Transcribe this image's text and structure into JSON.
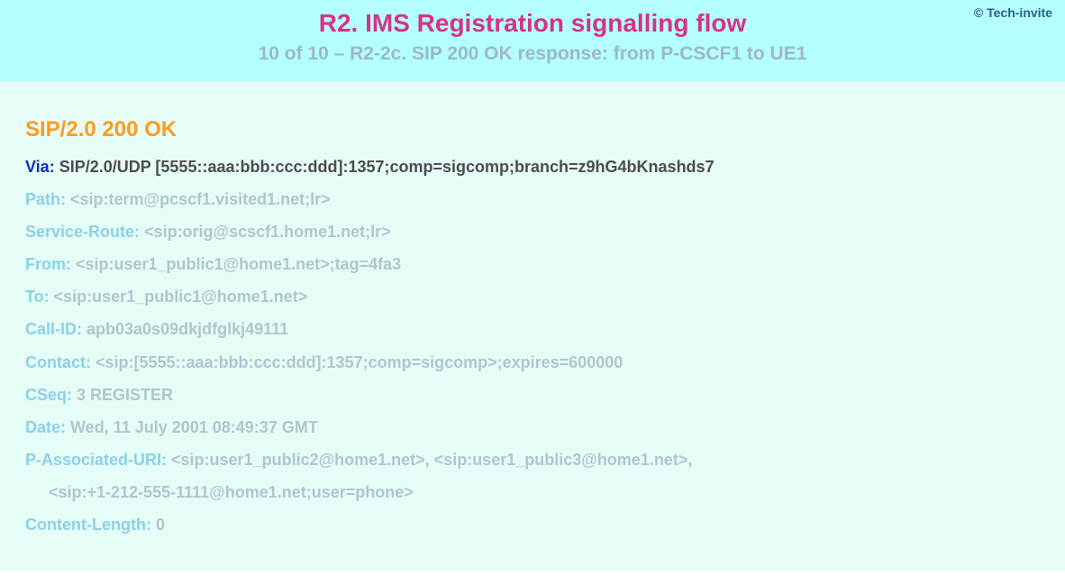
{
  "copyright": "© Tech-invite",
  "title": "R2. IMS Registration signalling flow",
  "subtitle": "10 of 10 – R2-2c. SIP 200 OK response: from P-CSCF1 to UE1",
  "status_line": "SIP/2.0 200 OK",
  "headers": [
    {
      "name": "Via",
      "value": "SIP/2.0/UDP [5555::aaa:bbb:ccc:ddd]:1357;comp=sigcomp;branch=z9hG4bKnashds7",
      "muted": false
    },
    {
      "name": "Path",
      "value": "<sip:term@pcscf1.visited1.net;lr>",
      "muted": true
    },
    {
      "name": "Service-Route",
      "value": "<sip:orig@scscf1.home1.net;lr>",
      "muted": true
    },
    {
      "name": "From",
      "value": "<sip:user1_public1@home1.net>;tag=4fa3",
      "muted": true
    },
    {
      "name": "To",
      "value": "<sip:user1_public1@home1.net>",
      "muted": true
    },
    {
      "name": "Call-ID",
      "value": "apb03a0s09dkjdfglkj49111",
      "muted": true
    },
    {
      "name": "Contact",
      "value": "<sip:[5555::aaa:bbb:ccc:ddd]:1357;comp=sigcomp>;expires=600000",
      "muted": true
    },
    {
      "name": "CSeq",
      "value": "3 REGISTER",
      "muted": true
    },
    {
      "name": "Date",
      "value": "Wed, 11 July 2001 08:49:37 GMT",
      "muted": true
    },
    {
      "name": "P-Associated-URI",
      "value": "<sip:user1_public2@home1.net>, <sip:user1_public3@home1.net>,",
      "muted": true
    },
    {
      "cont": true,
      "value": "<sip:+1-212-555-1111@home1.net;user=phone>",
      "muted": true
    },
    {
      "name": "Content-Length",
      "value": "0",
      "muted": true
    }
  ]
}
